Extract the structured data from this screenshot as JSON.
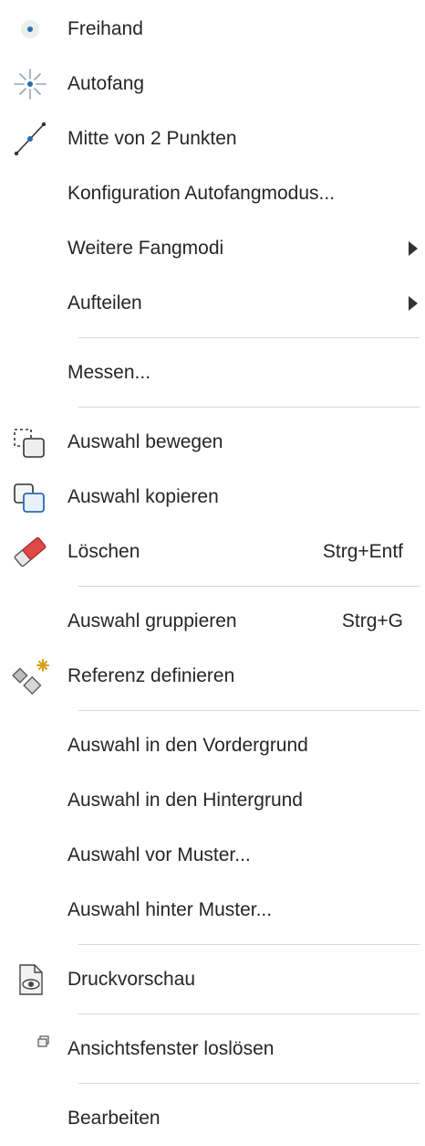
{
  "menu": {
    "items": [
      {
        "label": "Freihand",
        "icon": "freehand-point-icon"
      },
      {
        "label": "Autofang",
        "icon": "autosnap-star-icon"
      },
      {
        "label": "Mitte von 2 Punkten",
        "icon": "midpoint-line-icon"
      },
      {
        "label": "Konfiguration Autofangmodus..."
      },
      {
        "label": "Weitere Fangmodi",
        "submenu": true
      },
      {
        "label": "Aufteilen",
        "submenu": true
      },
      {
        "label": "Messen..."
      },
      {
        "label": "Auswahl bewegen",
        "icon": "move-selection-icon"
      },
      {
        "label": "Auswahl kopieren",
        "icon": "copy-selection-icon"
      },
      {
        "label": "Löschen",
        "shortcut": "Strg+Entf",
        "icon": "eraser-icon"
      },
      {
        "label": "Auswahl gruppieren",
        "shortcut": "Strg+G"
      },
      {
        "label": "Referenz definieren",
        "icon": "define-reference-icon"
      },
      {
        "label": "Auswahl in den Vordergrund"
      },
      {
        "label": "Auswahl in den Hintergrund"
      },
      {
        "label": "Auswahl vor Muster..."
      },
      {
        "label": "Auswahl hinter Muster..."
      },
      {
        "label": "Druckvorschau",
        "icon": "print-preview-icon"
      },
      {
        "label": "Ansichtsfenster loslösen",
        "icon": "detach-window-icon"
      },
      {
        "label": "Bearbeiten"
      }
    ]
  },
  "colors": {
    "accent_blue": "#2b6cb0",
    "eraser_red": "#e04848",
    "star_gold": "#d4a017",
    "separator": "#d9d9d9"
  }
}
